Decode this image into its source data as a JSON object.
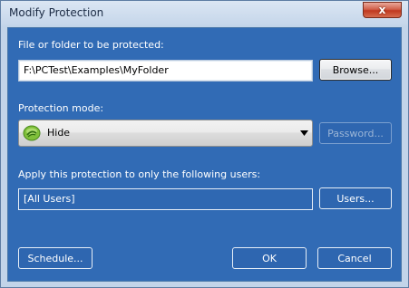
{
  "window": {
    "title": "Modify Protection",
    "close_glyph": "x"
  },
  "path_section": {
    "label": "File or folder to be protected:",
    "value": "F:\\PCTest\\Examples\\MyFolder",
    "browse_label": "Browse..."
  },
  "mode_section": {
    "label": "Protection mode:",
    "selected": "Hide",
    "selected_icon": "hide-shield-icon",
    "password_label": "Password..."
  },
  "users_section": {
    "label": "Apply this protection to only the following users:",
    "value": "[All Users]",
    "users_label": "Users..."
  },
  "footer": {
    "schedule_label": "Schedule...",
    "ok_label": "OK",
    "cancel_label": "Cancel"
  },
  "colors": {
    "client_background": "#316bb5",
    "title_bar": "#c5d6ea",
    "close_button": "#c0391f"
  }
}
